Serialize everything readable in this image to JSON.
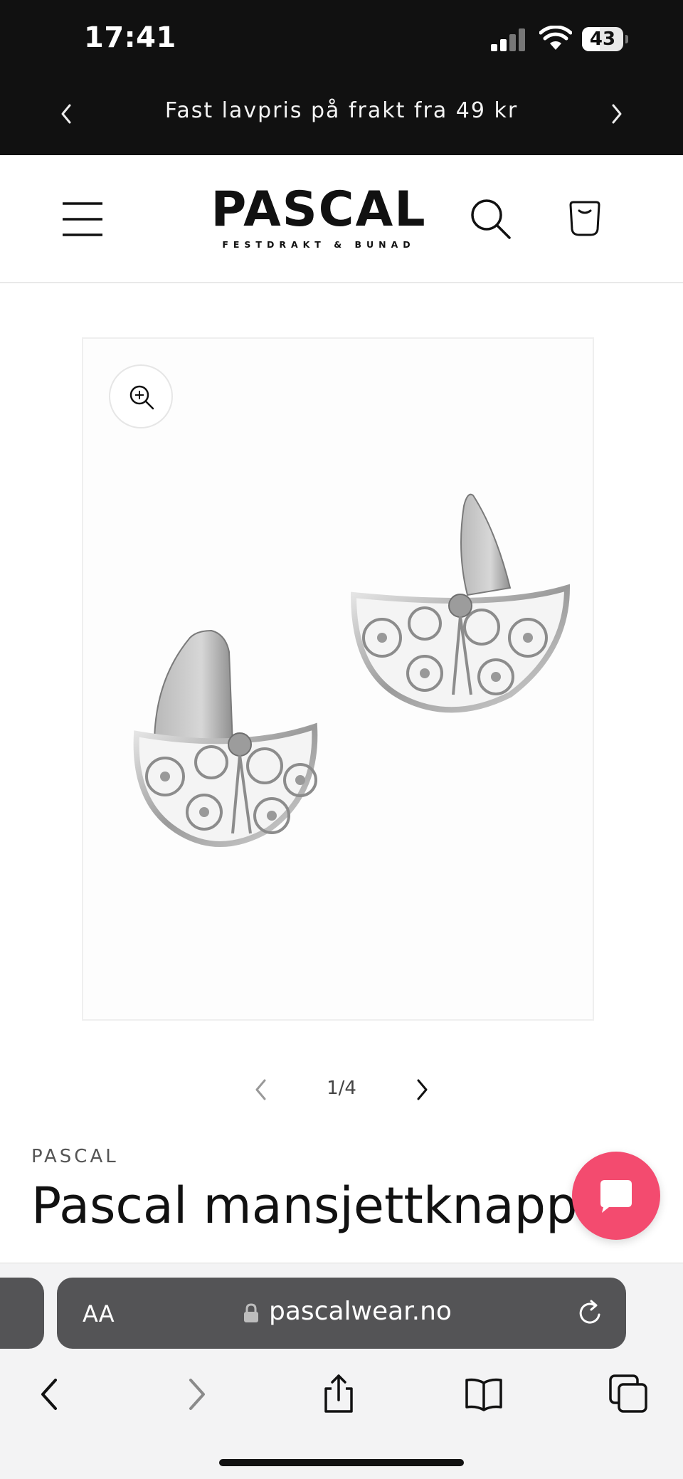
{
  "status_bar": {
    "time": "17:41",
    "battery_level": "43",
    "icons": [
      "signal-icon",
      "wifi-icon",
      "battery-icon"
    ]
  },
  "announcement": {
    "text": "Fast lavpris på frakt fra 49 kr",
    "prev_icon": "chevron-left-icon",
    "next_icon": "chevron-right-icon"
  },
  "header": {
    "logo_main": "PASCAL",
    "logo_sub": "FESTDRAKT & BUNAD",
    "icons": [
      "menu-icon",
      "search-icon",
      "cart-icon"
    ]
  },
  "product": {
    "image_alt": "Pascal mansjettknapper",
    "zoom_icon": "zoom-in-icon",
    "slider": {
      "current": 1,
      "total": 4,
      "counter_text": "1/4"
    },
    "vendor": "PASCAL",
    "title": "Pascal mansjettknapp"
  },
  "chat": {
    "icon": "chat-bubble-icon",
    "color": "#f34b6f"
  },
  "browser": {
    "aa_label": "AA",
    "url": "pascalwear.no",
    "toolbar_icons": [
      "back-icon",
      "forward-icon",
      "share-icon",
      "bookmarks-icon",
      "tabs-icon"
    ]
  },
  "colors": {
    "announcement_bg": "#111111",
    "chat_button": "#f34b6f",
    "url_bar": "#545456"
  }
}
